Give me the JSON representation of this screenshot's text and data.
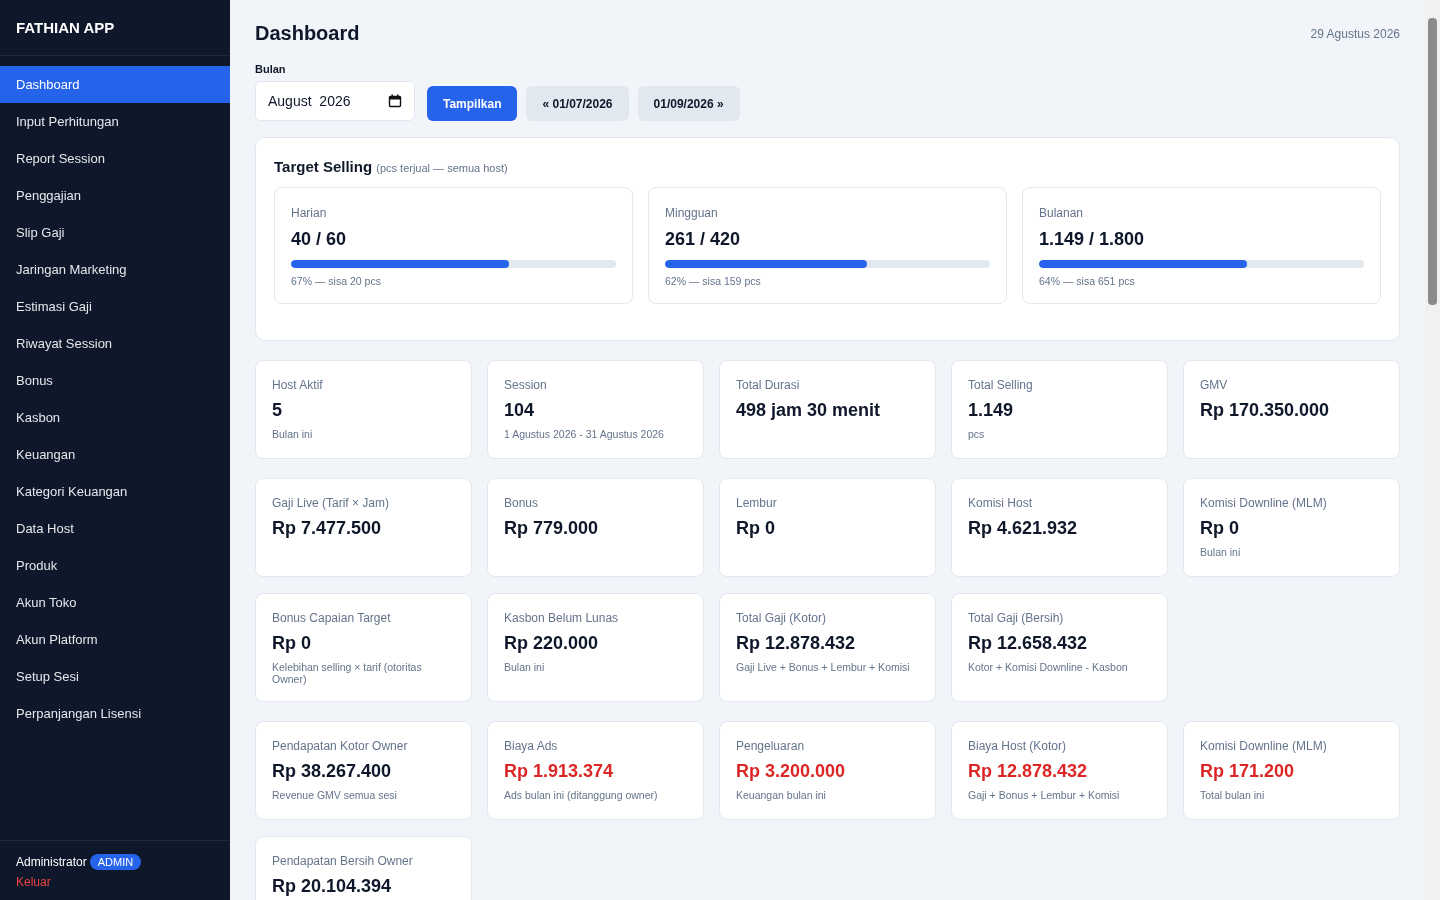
{
  "app": {
    "name": "FATHIAN APP"
  },
  "sidebar": {
    "items": [
      {
        "label": "Dashboard",
        "selected": true
      },
      {
        "label": "Input Perhitungan",
        "selected": false
      },
      {
        "label": "Report Session",
        "selected": false
      },
      {
        "label": "Penggajian",
        "selected": false
      },
      {
        "label": "Slip Gaji",
        "selected": false
      },
      {
        "label": "Jaringan Marketing",
        "selected": false
      },
      {
        "label": "Estimasi Gaji",
        "selected": false
      },
      {
        "label": "Riwayat Session",
        "selected": false
      },
      {
        "label": "Bonus",
        "selected": false
      },
      {
        "label": "Kasbon",
        "selected": false
      },
      {
        "label": "Keuangan",
        "selected": false
      },
      {
        "label": "Kategori Keuangan",
        "selected": false
      },
      {
        "label": "Data Host",
        "selected": false
      },
      {
        "label": "Produk",
        "selected": false
      },
      {
        "label": "Akun Toko",
        "selected": false
      },
      {
        "label": "Akun Platform",
        "selected": false
      },
      {
        "label": "Setup Sesi",
        "selected": false
      },
      {
        "label": "Perpanjangan Lisensi",
        "selected": false
      }
    ],
    "user": {
      "name": "Administrator",
      "role": "ADMIN",
      "logout": "Keluar"
    }
  },
  "header": {
    "title": "Dashboard",
    "date": "29 Agustus 2026"
  },
  "filter": {
    "label": "Bulan",
    "value": "August  2026",
    "submit": "Tampilkan",
    "prev": "« 01/07/2026",
    "next": "01/09/2026 »"
  },
  "target": {
    "title": "Target Selling",
    "subtitle": "(pcs terjual — semua host)",
    "periods": [
      {
        "label": "Harian",
        "value": "40 / 60",
        "level": 0.67,
        "note": "67% — sisa 20 pcs"
      },
      {
        "label": "Mingguan",
        "value": "261 / 420",
        "level": 0.62,
        "note": "62% — sisa 159 pcs"
      },
      {
        "label": "Bulanan",
        "value": "1.149 / 1.800",
        "level": 0.64,
        "note": "64% — sisa 651 pcs"
      }
    ]
  },
  "groups": [
    {
      "cards": [
        {
          "label": "Host Aktif",
          "value": "5",
          "note": "Bulan ini",
          "negative": false
        },
        {
          "label": "Session",
          "value": "104",
          "note": "1 Agustus 2026 - 31 Agustus 2026",
          "negative": false
        },
        {
          "label": "Total Durasi",
          "value": "498 jam 30 menit",
          "negative": false
        },
        {
          "label": "Total Selling",
          "value": "1.149",
          "note": "pcs",
          "negative": false
        },
        {
          "label": "GMV",
          "value": "Rp 170.350.000",
          "negative": false
        }
      ]
    },
    {
      "cards": [
        {
          "label": "Gaji Live (Tarif × Jam)",
          "value": "Rp 7.477.500",
          "negative": false
        },
        {
          "label": "Bonus",
          "value": "Rp 779.000",
          "negative": false
        },
        {
          "label": "Lembur",
          "value": "Rp 0",
          "negative": false
        },
        {
          "label": "Komisi Host",
          "value": "Rp 4.621.932",
          "negative": false
        },
        {
          "label": "Komisi Downline (MLM)",
          "value": "Rp 0",
          "note": "Bulan ini",
          "negative": false
        },
        {
          "label": "Bonus Capaian Target",
          "value": "Rp 0",
          "note": "Kelebihan selling × tarif (otoritas Owner)",
          "negative": false
        },
        {
          "label": "Kasbon Belum Lunas",
          "value": "Rp 220.000",
          "note": "Bulan ini",
          "negative": false
        },
        {
          "label": "Total Gaji (Kotor)",
          "value": "Rp 12.878.432",
          "note": "Gaji Live + Bonus + Lembur + Komisi",
          "negative": false
        },
        {
          "label": "Total Gaji (Bersih)",
          "value": "Rp 12.658.432",
          "note": "Kotor + Komisi Downline - Kasbon",
          "negative": false
        }
      ]
    },
    {
      "cards": [
        {
          "label": "Pendapatan Kotor Owner",
          "value": "Rp 38.267.400",
          "note": "Revenue GMV semua sesi",
          "negative": false
        },
        {
          "label": "Biaya Ads",
          "value": "Rp 1.913.374",
          "note": "Ads bulan ini (ditanggung owner)",
          "negative": true
        },
        {
          "label": "Pengeluaran",
          "value": "Rp 3.200.000",
          "note": "Keuangan bulan ini",
          "negative": true
        },
        {
          "label": "Biaya Host (Kotor)",
          "value": "Rp 12.878.432",
          "note": "Gaji + Bonus + Lembur + Komisi",
          "negative": true
        },
        {
          "label": "Komisi Downline (MLM)",
          "value": "Rp 171.200",
          "note": "Total bulan ini",
          "negative": true
        },
        {
          "label": "Pendapatan Bersih Owner",
          "value": "Rp 20.104.394",
          "negative": false
        }
      ]
    }
  ]
}
